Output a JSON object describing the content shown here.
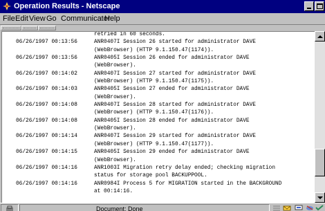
{
  "window": {
    "title": "Operation Results - Netscape",
    "app_icon": "netscape-icon"
  },
  "menu": [
    {
      "label": "File"
    },
    {
      "label": "Edit"
    },
    {
      "label": "View"
    },
    {
      "label": "Go"
    },
    {
      "label": "Communicator"
    },
    {
      "label": "Help"
    }
  ],
  "log": [
    {
      "ts": "",
      "msg": "retried in 60 seconds."
    },
    {
      "ts": "06/26/1997 00:13:56",
      "msg": "ANR0407I Session 26 started for administrator DAVE"
    },
    {
      "ts": "",
      "msg": "(WebBrowser) (HTTP 9.1.150.47(1174))."
    },
    {
      "ts": "06/26/1997 00:13:56",
      "msg": "ANR0405I Session 26 ended for administrator DAVE"
    },
    {
      "ts": "",
      "msg": "(WebBrowser)."
    },
    {
      "ts": "06/26/1997 00:14:02",
      "msg": "ANR0407I Session 27 started for administrator DAVE"
    },
    {
      "ts": "",
      "msg": "(WebBrowser) (HTTP 9.1.150.47(1175))."
    },
    {
      "ts": "06/26/1997 00:14:03",
      "msg": "ANR0405I Session 27 ended for administrator DAVE"
    },
    {
      "ts": "",
      "msg": "(WebBrowser)."
    },
    {
      "ts": "06/26/1997 00:14:08",
      "msg": "ANR0407I Session 28 started for administrator DAVE"
    },
    {
      "ts": "",
      "msg": "(WebBrowser) (HTTP 9.1.150.47(1176))."
    },
    {
      "ts": "06/26/1997 00:14:08",
      "msg": "ANR0405I Session 28 ended for administrator DAVE"
    },
    {
      "ts": "",
      "msg": "(WebBrowser)."
    },
    {
      "ts": "06/26/1997 00:14:14",
      "msg": "ANR0407I Session 29 started for administrator DAVE"
    },
    {
      "ts": "",
      "msg": "(WebBrowser) (HTTP 9.1.150.47(1177))."
    },
    {
      "ts": "06/26/1997 00:14:15",
      "msg": "ANR0405I Session 29 ended for administrator DAVE"
    },
    {
      "ts": "",
      "msg": "(WebBrowser)."
    },
    {
      "ts": "06/26/1997 00:14:16",
      "msg": "ANR1003I Migration retry delay ended; checking migration"
    },
    {
      "ts": "",
      "msg": "status for storage pool BACKUPPOOL."
    },
    {
      "ts": "06/26/1997 00:14:16",
      "msg": "ANR0984I Process 5 for MIGRATION started in the BACKGROUND"
    },
    {
      "ts": "",
      "msg": "at 00:14:16."
    }
  ],
  "status": {
    "text": "Document: Done",
    "icons": [
      "security-lock-icon",
      "component-bar-icon",
      "mail-icon",
      "discussion-icon",
      "composer-icon"
    ]
  }
}
